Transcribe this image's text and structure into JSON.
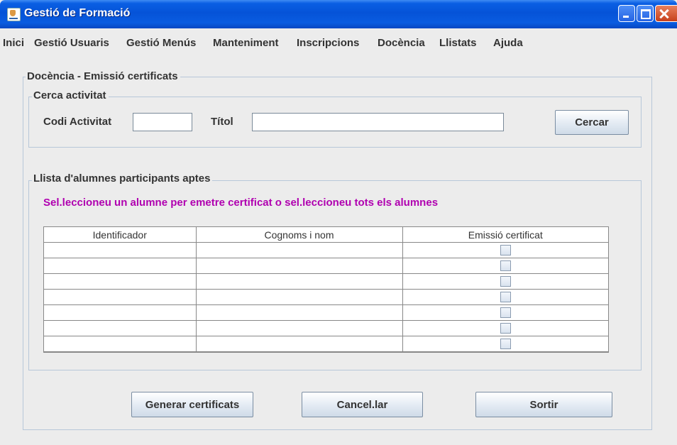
{
  "window": {
    "title": "Gestió de Formació"
  },
  "menu": {
    "items": [
      "Inici",
      "Gestió Usuaris",
      "Gestió Menús",
      "Manteniment",
      "Inscripcions",
      "Docència",
      "Llistats",
      "Ajuda"
    ]
  },
  "main_panel": {
    "legend": "Docència - Emissió certificats"
  },
  "search": {
    "legend": "Cerca activitat",
    "code_label": "Codi Activitat",
    "code_value": "",
    "title_label": "Títol",
    "title_value": "",
    "search_button": "Cercar"
  },
  "students": {
    "legend": "Llista d'alumnes participants aptes",
    "hint": "Sel.leccioneu un alumne per emetre certificat o sel.leccioneu tots els alumnes",
    "hint_color": "#b000b0",
    "columns": [
      "Identificador",
      "Cognoms i nom",
      "Emissió certificat"
    ],
    "rows": [
      {
        "id": "",
        "name": "",
        "issue": false
      },
      {
        "id": "",
        "name": "",
        "issue": false
      },
      {
        "id": "",
        "name": "",
        "issue": false
      },
      {
        "id": "",
        "name": "",
        "issue": false
      },
      {
        "id": "",
        "name": "",
        "issue": false
      },
      {
        "id": "",
        "name": "",
        "issue": false
      },
      {
        "id": "",
        "name": "",
        "issue": false
      }
    ]
  },
  "actions": {
    "generate": "Generar certificats",
    "cancel": "Cancel.lar",
    "exit": "Sortir"
  }
}
